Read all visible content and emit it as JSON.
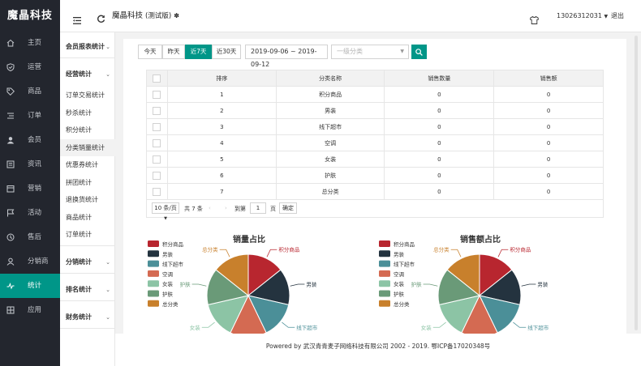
{
  "sidebar": {
    "logo": "魔晶科技",
    "items": [
      {
        "label": "主页",
        "icon": "home-icon"
      },
      {
        "label": "运营",
        "icon": "shield-icon"
      },
      {
        "label": "商品",
        "icon": "tag-icon"
      },
      {
        "label": "订单",
        "icon": "list-icon"
      },
      {
        "label": "会员",
        "icon": "member-icon"
      },
      {
        "label": "资讯",
        "icon": "news-icon"
      },
      {
        "label": "营销",
        "icon": "marketing-icon"
      },
      {
        "label": "活动",
        "icon": "flag-icon"
      },
      {
        "label": "售后",
        "icon": "aftersale-icon"
      },
      {
        "label": "分销商",
        "icon": "user-icon"
      },
      {
        "label": "统计",
        "icon": "chart-line-icon",
        "active": true
      },
      {
        "label": "应用",
        "icon": "app-icon"
      }
    ]
  },
  "submenu": {
    "groups": [
      {
        "label": "会员报表统计",
        "items": []
      },
      {
        "label": "经营统计",
        "items": [
          "订单交易统计",
          "秒杀统计",
          "积分统计",
          "分类销量统计",
          "优惠券统计",
          "拼团统计",
          "退换货统计",
          "商品统计",
          "订单统计"
        ]
      },
      {
        "label": "分销统计",
        "items": []
      },
      {
        "label": "排名统计",
        "items": []
      },
      {
        "label": "财务统计",
        "items": []
      }
    ],
    "active_item": "分类销量统计"
  },
  "header": {
    "brand": "魔晶科技",
    "version": "(测试版)",
    "user": "13026312031",
    "logout": "退出"
  },
  "filters": {
    "quick": [
      "今天",
      "昨天",
      "近7天",
      "近30天"
    ],
    "active_quick": "近7天",
    "date_range": "2019-09-06 ~ 2019-09-12",
    "category_placeholder": "一级分类"
  },
  "table": {
    "columns": [
      "排序",
      "分类名称",
      "销售数量",
      "销售额"
    ],
    "rows": [
      [
        "1",
        "积分商品",
        "0",
        "0"
      ],
      [
        "2",
        "男装",
        "0",
        "0"
      ],
      [
        "3",
        "线下超市",
        "0",
        "0"
      ],
      [
        "4",
        "空调",
        "0",
        "0"
      ],
      [
        "5",
        "女装",
        "0",
        "0"
      ],
      [
        "6",
        "护肤",
        "0",
        "0"
      ],
      [
        "7",
        "总分类",
        "0",
        "0"
      ]
    ]
  },
  "pagination": {
    "page_size": "10 条/页",
    "total": "共 7 条",
    "goto": "到第",
    "page": "1",
    "page_unit": "页",
    "confirm": "确定"
  },
  "chart_data": [
    {
      "type": "pie",
      "title": "销量占比",
      "categories": [
        "积分商品",
        "男装",
        "线下超市",
        "空调",
        "女装",
        "护肤",
        "总分类"
      ],
      "values": [
        1,
        1,
        1,
        1,
        1,
        1,
        1
      ],
      "colors": [
        "#b8262f",
        "#24333f",
        "#4b8f98",
        "#d46a52",
        "#8cc4a5",
        "#6a9a78",
        "#c8802c"
      ],
      "legend": "top-left"
    },
    {
      "type": "pie",
      "title": "销售额占比",
      "categories": [
        "积分商品",
        "男装",
        "线下超市",
        "空调",
        "女装",
        "护肤",
        "总分类"
      ],
      "values": [
        1,
        1,
        1,
        1,
        1,
        1,
        1
      ],
      "colors": [
        "#b8262f",
        "#24333f",
        "#4b8f98",
        "#d46a52",
        "#8cc4a5",
        "#6a9a78",
        "#c8802c"
      ],
      "legend": "top-left"
    }
  ],
  "footer": "Powered by 武汉青青麦子网络科技有限公司 2002 - 2019. 鄂ICP备17020348号"
}
